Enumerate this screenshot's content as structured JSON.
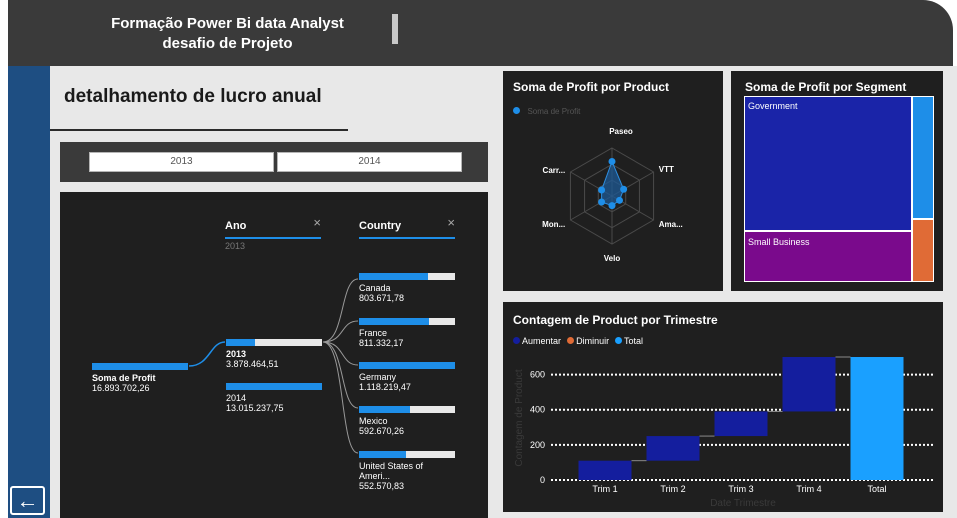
{
  "header": {
    "title_line1": "Formação Power Bi data Analyst",
    "title_line2": "desafio de Projeto"
  },
  "page_title": "detalhamento de lucro anual",
  "slicer": {
    "options": [
      "2013",
      "2014"
    ]
  },
  "decomposition": {
    "columns": [
      {
        "label": "Ano",
        "sub": "2013",
        "close": "×"
      },
      {
        "label": "Country",
        "close": "×"
      }
    ],
    "root": {
      "label": "Soma de Profit",
      "value": "16.893.702,26"
    },
    "years": [
      {
        "label": "2013",
        "value": "3.878.464,51",
        "fill": 0.3
      },
      {
        "label": "2014",
        "value": "13.015.237,75",
        "fill": 1.0
      }
    ],
    "countries": [
      {
        "label": "Canada",
        "value": "803.671,78",
        "fill": 0.72
      },
      {
        "label": "France",
        "value": "811.332,17",
        "fill": 0.73
      },
      {
        "label": "Germany",
        "value": "1.118.219,47",
        "fill": 1.0
      },
      {
        "label": "Mexico",
        "value": "592.670,26",
        "fill": 0.53
      },
      {
        "label": "United States of Ameri...",
        "value": "552.570,83",
        "fill": 0.49
      }
    ]
  },
  "chart_data": [
    {
      "type": "radar",
      "title": "Soma de Profit por Product",
      "legend": [
        "Soma de Profit"
      ],
      "categories": [
        "Paseo",
        "VTT",
        "Ama...",
        "Velo",
        "Mon...",
        "Carr..."
      ],
      "values": [
        0.72,
        0.28,
        0.18,
        0.2,
        0.25,
        0.25
      ]
    },
    {
      "type": "treemap",
      "title": "Soma de Profit por Segment",
      "items": [
        {
          "label": "Government",
          "color": "#1a24a8"
        },
        {
          "label": "Small Business",
          "color": "#7a0a8c"
        },
        {
          "label": "",
          "color": "#1e8ee8"
        },
        {
          "label": "",
          "color": "#e06b36"
        }
      ]
    },
    {
      "type": "waterfall",
      "title": "Contagem de Product por Trimestre",
      "legend": [
        {
          "name": "Aumentar",
          "color": "#141e9e"
        },
        {
          "name": "Diminuir",
          "color": "#e06b36"
        },
        {
          "name": "Total",
          "color": "#1aa0ff"
        }
      ],
      "xlabel": "Date Trimestre",
      "ylabel": "Contagem de Product",
      "categories": [
        "Trim 1",
        "Trim 2",
        "Trim 3",
        "Trim 4",
        "Total"
      ],
      "steps": [
        {
          "start": 0,
          "end": 110,
          "kind": "increase"
        },
        {
          "start": 110,
          "end": 250,
          "kind": "increase"
        },
        {
          "start": 250,
          "end": 390,
          "kind": "increase"
        },
        {
          "start": 390,
          "end": 700,
          "kind": "increase"
        },
        {
          "start": 0,
          "end": 700,
          "kind": "total"
        }
      ],
      "yticks": [
        "0",
        "200",
        "400",
        "600"
      ],
      "ylim": [
        0,
        700
      ]
    }
  ],
  "nav": {
    "back_icon": "←"
  }
}
